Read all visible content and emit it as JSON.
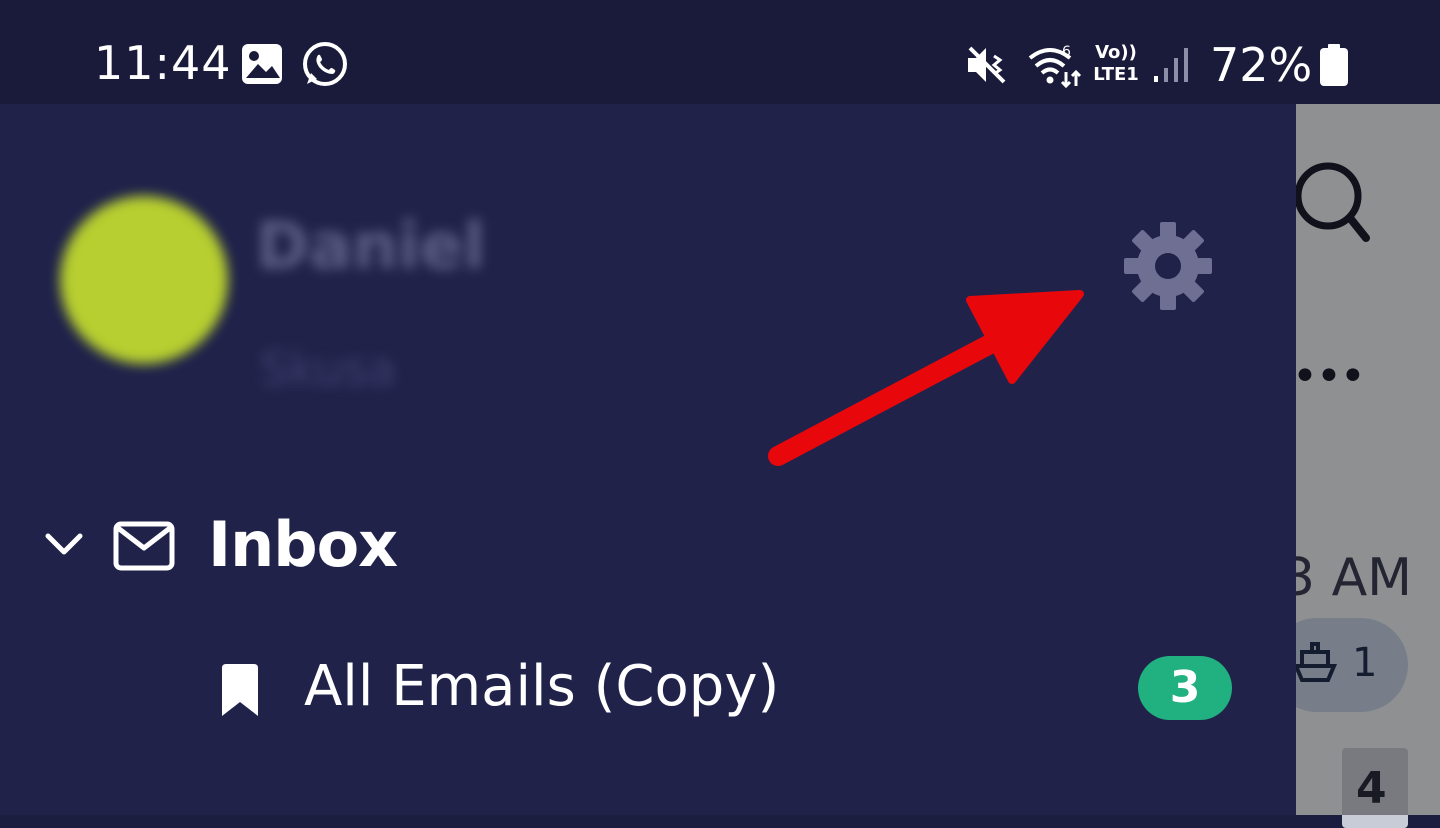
{
  "status_bar": {
    "time": "11:44",
    "battery_percent": "72%",
    "network": "Vo)) LTE1",
    "wifi_label": "6"
  },
  "account": {
    "name": "Daniel",
    "subtitle": "Skusa"
  },
  "folders": {
    "inbox_label": "Inbox",
    "subfolder_label": "All Emails (Copy)",
    "subfolder_count": "3"
  },
  "background": {
    "time_text": "3 AM",
    "chip_count": "1",
    "badge_count": "4"
  },
  "colors": {
    "drawer": "#20224a",
    "status_bar": "#1a1b3a",
    "badge_green": "#21b07f",
    "annotation_red": "#e8080c",
    "gear": "#6e6f93"
  },
  "icons": [
    "image-icon",
    "whatsapp-icon",
    "vibrate-mute-icon",
    "wifi-icon",
    "signal-icon",
    "battery-icon",
    "settings-gear-icon",
    "chevron-down-icon",
    "mail-icon",
    "bookmark-icon",
    "search-icon",
    "more-icon",
    "ship-icon"
  ]
}
